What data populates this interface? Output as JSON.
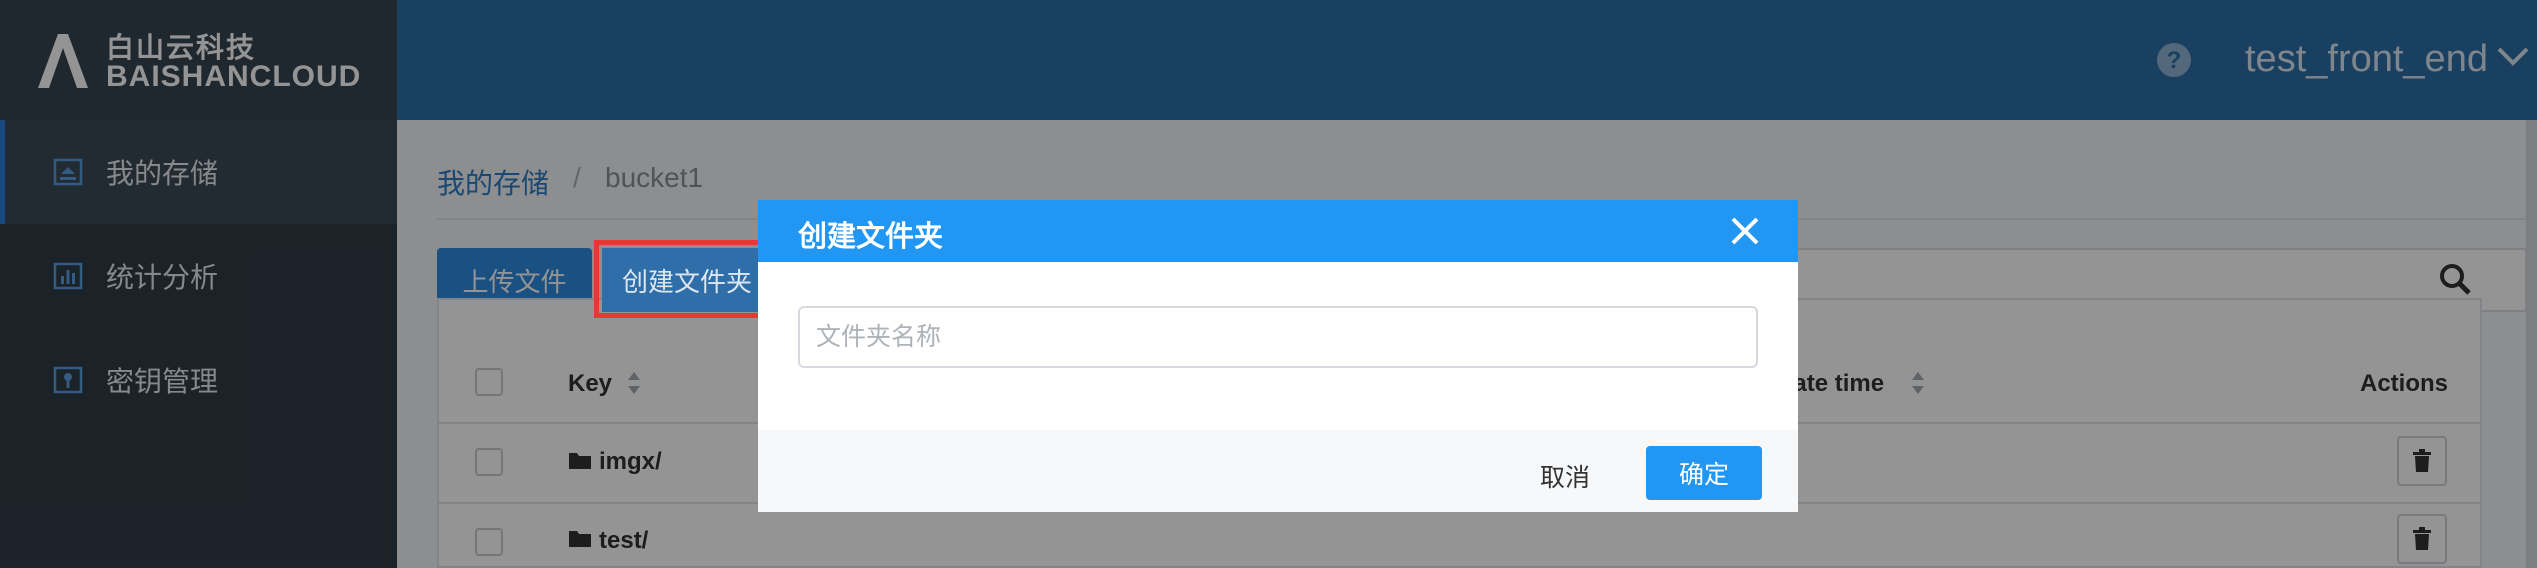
{
  "brand": {
    "name_cn": "白山云科技",
    "name_en": "BAISHANCLOUD"
  },
  "sidebar": {
    "items": [
      {
        "label": "我的存储",
        "icon": "storage-icon",
        "active": true
      },
      {
        "label": "统计分析",
        "icon": "chart-icon",
        "active": false
      },
      {
        "label": "密钥管理",
        "icon": "key-icon",
        "active": false
      }
    ]
  },
  "header": {
    "help_icon": "help-icon",
    "username": "test_front_end"
  },
  "breadcrumb": {
    "root": "我的存储",
    "separator": "/",
    "current": "bucket1"
  },
  "toolbar": {
    "upload_label": "上传文件",
    "create_folder_label": "创建文件夹"
  },
  "table": {
    "columns": {
      "key": "Key",
      "create_time": "eate time",
      "actions": "Actions"
    },
    "rows": [
      {
        "name": "imgx/"
      },
      {
        "name": "test/"
      }
    ]
  },
  "modal": {
    "title": "创建文件夹",
    "input_placeholder": "文件夹名称",
    "input_value": "",
    "cancel_label": "取消",
    "confirm_label": "确定"
  },
  "colors": {
    "header": "#2d6ea7",
    "sidebar": "#2f3b46",
    "accent": "#2196f3",
    "highlight": "#e53935"
  }
}
